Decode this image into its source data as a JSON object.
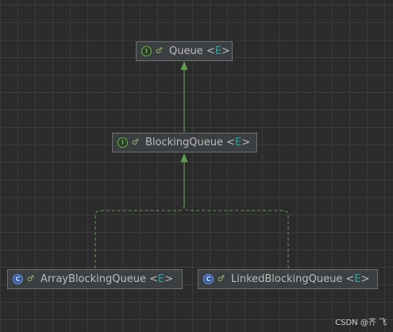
{
  "diagram": {
    "nodes": [
      {
        "id": "queue",
        "kind_icon": "interface-icon",
        "kind_letter": "I",
        "visibility_icon": "public-icon",
        "name": "Queue",
        "type_param": "E"
      },
      {
        "id": "blocking_queue",
        "kind_icon": "interface-icon",
        "kind_letter": "I",
        "visibility_icon": "public-icon",
        "name": "BlockingQueue",
        "type_param": "E"
      },
      {
        "id": "array_blocking_queue",
        "kind_icon": "class-icon",
        "kind_letter": "C",
        "visibility_icon": "public-icon",
        "name": "ArrayBlockingQueue",
        "type_param": "E"
      },
      {
        "id": "linked_blocking_queue",
        "kind_icon": "class-icon",
        "kind_letter": "C",
        "visibility_icon": "public-icon",
        "name": "LinkedBlockingQueue",
        "type_param": "E"
      }
    ],
    "edges": [
      {
        "from": "blocking_queue",
        "to": "queue",
        "relation": "extends",
        "style": "solid"
      },
      {
        "from": "array_blocking_queue",
        "to": "blocking_queue",
        "relation": "implements",
        "style": "dashed"
      },
      {
        "from": "linked_blocking_queue",
        "to": "blocking_queue",
        "relation": "implements",
        "style": "dashed"
      }
    ]
  },
  "colors": {
    "background": "#2b2b2b",
    "grid": "#3b3b3b",
    "node_fill": "#3c3f41",
    "node_border": "#6e6e6e",
    "edge": "#5f9e52",
    "type_param": "#29a3a3"
  },
  "watermark": "CSDN @齐 飞"
}
